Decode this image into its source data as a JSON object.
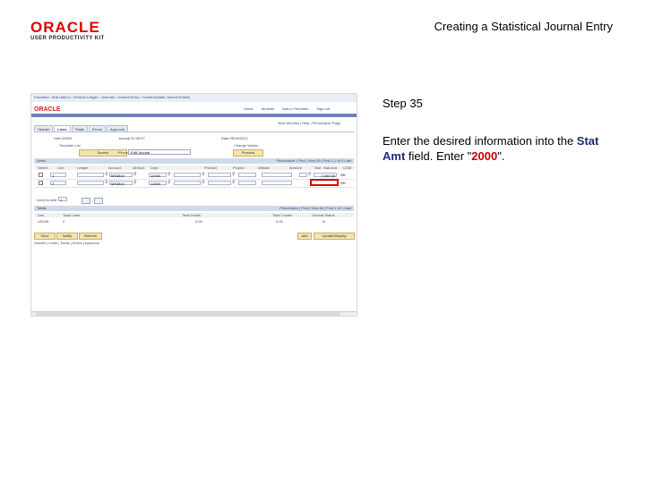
{
  "logo": {
    "brand": "ORACLE",
    "product": "USER PRODUCTIVITY KIT"
  },
  "document_title": "Creating a Statistical Journal Entry",
  "step": {
    "title": "Step 35"
  },
  "instructions": {
    "text_before": "Enter the desired information into the ",
    "field_name": "Stat Amt",
    "text_middle": " field. Enter \"",
    "value": "2000",
    "text_after": "\"."
  },
  "screenshot": {
    "nav_text": "Favorites › Main Menu › General Ledger › Journals › Journal Entry › Create/Update Journal Entries",
    "brand": "ORACLE",
    "top_links": [
      "Home",
      "Worklist",
      "Add to Favorites",
      "Sign out"
    ],
    "utility_links": "New Window | Help | Personalize Page",
    "tabs": [
      "Header",
      "Lines",
      "Totals",
      "Errors",
      "Approval"
    ],
    "header_left": "Unit  US005",
    "header_mid": "Journal ID  NEXT",
    "header_right": "Date  05/16/2012",
    "template_link": "Template List",
    "change_values_link": "Change Values",
    "buttons": {
      "search": "Search",
      "process": "Process",
      "save": "Save",
      "notify": "Notify",
      "refresh": "Refresh",
      "add": "Add",
      "update_inquiry": "Update/Display"
    },
    "process_label": "*Process",
    "process_value": "Edit Journal",
    "lines_bar": "Lines",
    "lines_bar_right": "Personalize | Find | View All | First 1-2 of 2 Last",
    "lines_columns": [
      "Select",
      "Line",
      "Ledger",
      "Account",
      "Alt Acct",
      "Dept",
      "Product",
      "Project",
      "Affiliate",
      "Amount",
      "Stat",
      "Stat Amt",
      "UOM"
    ],
    "rows": [
      {
        "line": "1",
        "account": "MS3810",
        "dept": "12000",
        "stat": "SH",
        "stat_amt": "1,000.00"
      },
      {
        "line": "2",
        "account": "MS3810",
        "dept": "12000",
        "stat": "SH",
        "stat_amt": ""
      }
    ],
    "lines_to_add_label": "Lines to add",
    "lines_to_add_value": "1",
    "totals_bar": "Totals",
    "totals_bar_right": "Personalize | Find | View All | First 1 of 1 Last",
    "totals_columns": [
      "Unit",
      "Total Lines",
      "Total Debits",
      "Total Credits",
      "Journal Status"
    ],
    "totals_row": [
      "US005",
      "2",
      "0.00",
      "0.00",
      "N"
    ],
    "footer_links": "Header | Lines | Totals | Errors | Approval"
  },
  "colors": {
    "brand_red": "#e10000",
    "field_blue": "#1a2a78",
    "value_red": "#c00000",
    "highlight_red": "#d40000"
  }
}
